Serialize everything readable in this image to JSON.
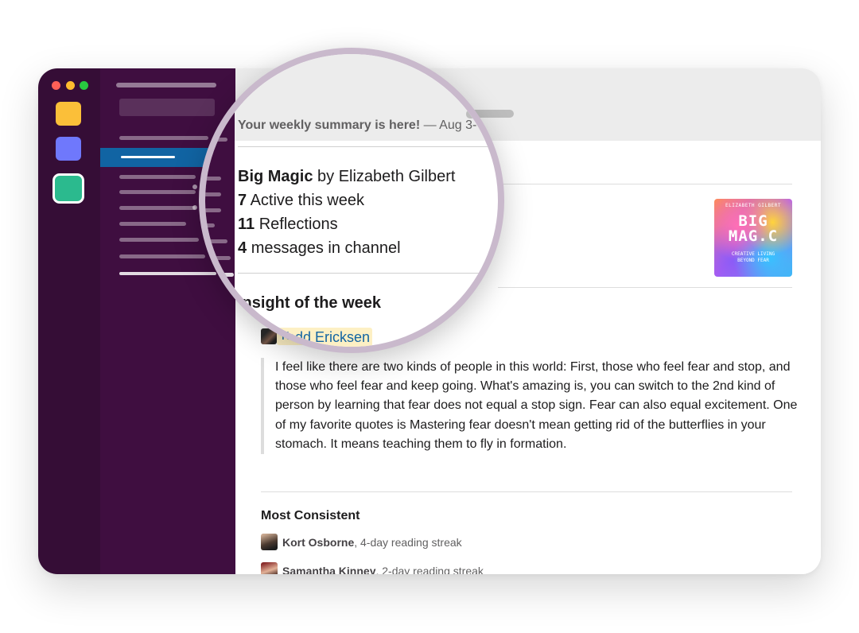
{
  "window": {
    "controls": [
      "close",
      "minimize",
      "zoom"
    ],
    "workspace_icons": [
      "workspace-yellow",
      "workspace-blue",
      "workspace-green"
    ],
    "colors": {
      "rail": "#350d36",
      "sidebar": "#3f0e40",
      "selected": "#1164a3",
      "mention_bg": "#fdf0c4",
      "mention_text": "#1264a3"
    }
  },
  "summary": {
    "title": "Your weekly summary is here!",
    "date": "— Aug 3-"
  },
  "book": {
    "title": "Big Magic",
    "by": "by Elizabeth Gilbert",
    "cover": {
      "author": "ELIZABETH GILBERT",
      "title_line1": "BIG",
      "title_line2": "MAG.C",
      "subtitle_line1": "CREATIVE LIVING",
      "subtitle_line2": "BEYOND FEAR"
    }
  },
  "stats": [
    {
      "value": "7",
      "label": "Active this week"
    },
    {
      "value": "11",
      "label": "Reflections"
    },
    {
      "value": "4",
      "label": "messages in channel"
    }
  ],
  "insight": {
    "heading": "Insight of the week",
    "author": "Todd Ericksen",
    "quote": "I feel like there are two kinds of people in this world: First, those who feel fear and stop, and those who feel fear and keep going. What's amazing is, you can switch to the 2nd kind of person by learning that fear does not equal a stop sign. Fear can also equal excitement. One of my favorite quotes is Mastering fear doesn't mean getting rid of the butterflies in your stomach. It means teaching them to fly in formation."
  },
  "most_consistent": {
    "heading": "Most Consistent",
    "entries": [
      {
        "name": "Kort Osborne",
        "detail": ", 4-day reading streak"
      },
      {
        "name": "Samantha Kinney",
        "detail": ", 2-day reading streak"
      }
    ]
  }
}
